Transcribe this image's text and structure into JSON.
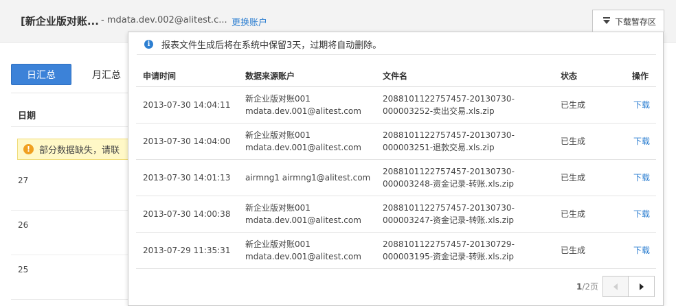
{
  "header": {
    "account_name": "[新企业版对账...",
    "account_email": "- mdata.dev.002@alitest.c...",
    "switch_account": "更换账户",
    "download_area_label": "下载暂存区",
    "download_icon": "download-arrow-icon"
  },
  "background": {
    "tabs": [
      {
        "label": "日汇总",
        "active": true
      },
      {
        "label": "月汇总",
        "active": false
      }
    ],
    "date_header": "日期",
    "warning_text": "部分数据缺失，请联",
    "warning_icon": "exclamation-icon",
    "rows": [
      "27",
      "26",
      "25"
    ]
  },
  "popup": {
    "notice_icon": "info-icon",
    "notice_text": "报表文件生成后将在系统中保留3天，过期将自动删除。",
    "columns": [
      "申请时间",
      "数据来源账户",
      "文件名",
      "状态",
      "操作"
    ],
    "rows": [
      {
        "time": "2013-07-30 14:04:11",
        "account_line1": "新企业版对账001",
        "account_line2": "mdata.dev.001@alitest.com",
        "file_line1": "2088101122757457-20130730-",
        "file_line2": "000003252-卖出交易.xls.zip",
        "status": "已生成",
        "action": "下载"
      },
      {
        "time": "2013-07-30 14:04:00",
        "account_line1": "新企业版对账001",
        "account_line2": "mdata.dev.001@alitest.com",
        "file_line1": "2088101122757457-20130730-",
        "file_line2": "000003251-退款交易.xls.zip",
        "status": "已生成",
        "action": "下载"
      },
      {
        "time": "2013-07-30 14:01:13",
        "account_line1": "airmng1 airmng1@alitest.com",
        "account_line2": "",
        "file_line1": "2088101122757457-20130730-",
        "file_line2": "000003248-资金记录-转账.xls.zip",
        "status": "已生成",
        "action": "下载"
      },
      {
        "time": "2013-07-30 14:00:38",
        "account_line1": "新企业版对账001",
        "account_line2": "mdata.dev.001@alitest.com",
        "file_line1": "2088101122757457-20130730-",
        "file_line2": "000003247-资金记录-转账.xls.zip",
        "status": "已生成",
        "action": "下载"
      },
      {
        "time": "2013-07-29 11:35:31",
        "account_line1": "新企业版对账001",
        "account_line2": "mdata.dev.001@alitest.com",
        "file_line1": "2088101122757457-20130729-",
        "file_line2": "000003195-资金记录-转账.xls.zip",
        "status": "已生成",
        "action": "下载"
      }
    ],
    "pager": {
      "current": "1",
      "total_text": "/2页",
      "prev_icon": "chevron-left-icon",
      "next_icon": "chevron-right-icon"
    }
  },
  "colors": {
    "link": "#2d7fd1",
    "tab_active": "#3c82d8",
    "warning_bg": "#fff8c7",
    "warning_icon": "#f0a020"
  }
}
